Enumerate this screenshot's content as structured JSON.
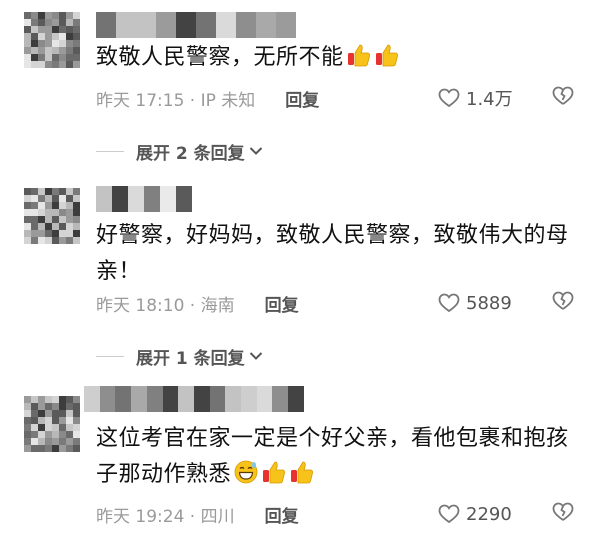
{
  "comments": [
    {
      "text": "致敬人民警察，无所不能",
      "emojis": [
        "thumbs-up",
        "thumbs-up"
      ],
      "time_location": "昨天 17:15 · IP 未知",
      "reply_label": "回复",
      "likes": "1.4万",
      "expand_label": "展开 2 条回复"
    },
    {
      "text": "好警察，好妈妈，致敬人民警察，致敬伟大的母亲！",
      "emojis": [],
      "time_location": "昨天 18:10 · 海南",
      "reply_label": "回复",
      "likes": "5889",
      "expand_label": "展开 1 条回复"
    },
    {
      "text": "这位考官在家一定是个好父亲，看他包裹和抱孩子那动作熟悉",
      "emojis": [
        "grinning-sweat",
        "thumbs-up",
        "thumbs-up"
      ],
      "time_location": "昨天 19:24 · 四川",
      "reply_label": "回复",
      "likes": "2290"
    }
  ],
  "colors": {
    "meta_gray": "#9a9a9a",
    "reply_gray": "#555555",
    "emoji_yellow": "#f7c21a",
    "emoji_red": "#e8322f"
  }
}
